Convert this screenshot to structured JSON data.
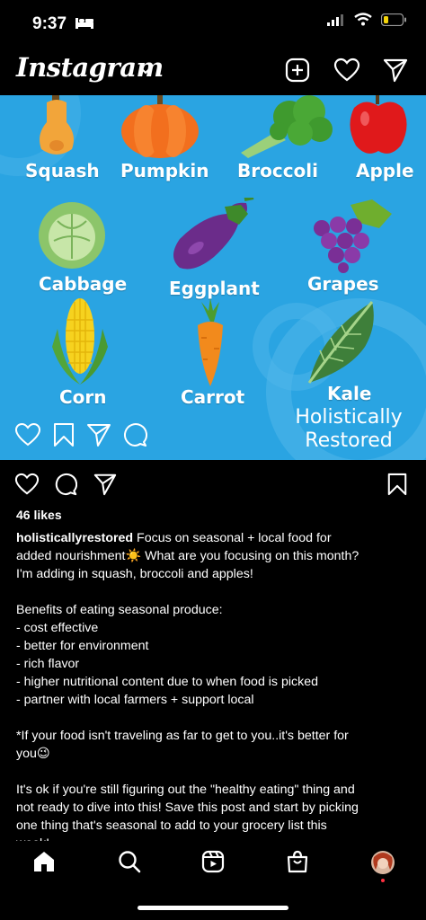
{
  "status_bar": {
    "time": "9:37",
    "icons": [
      "bed-icon",
      "signal-icon",
      "wifi-icon",
      "battery-low-icon"
    ]
  },
  "header": {
    "logo": "Instagram",
    "icons": [
      "chevron-down-icon",
      "new-post-icon",
      "heart-icon",
      "send-icon"
    ]
  },
  "post_image": {
    "produce": [
      {
        "label": "Squash"
      },
      {
        "label": "Pumpkin"
      },
      {
        "label": "Broccoli"
      },
      {
        "label": "Apple"
      },
      {
        "label": "Cabbage"
      },
      {
        "label": "Eggplant"
      },
      {
        "label": "Grapes"
      },
      {
        "label": "Corn"
      },
      {
        "label": "Carrot"
      },
      {
        "label": "Kale"
      }
    ],
    "brand_line1": "Holistically",
    "brand_line2": "Restored",
    "overlay_icons": [
      "heart-outline-icon",
      "bookmark-outline-icon",
      "send-outline-icon",
      "comment-outline-icon"
    ],
    "colors": {
      "background": "#2aa4e2"
    }
  },
  "actions": {
    "icons": [
      "like-icon",
      "comment-icon",
      "share-icon",
      "save-icon"
    ]
  },
  "likes": "46 likes",
  "caption": {
    "username": "holisticallyrestored",
    "line1_text": " Focus on seasonal + local food for",
    "line2": "added nourishment☀️ What are you focusing on this month?",
    "line3": "I'm adding in squash, broccoli and apples!",
    "benefits_title": "Benefits of eating seasonal produce:",
    "benefits": [
      "- cost effective",
      "- better for environment",
      "- rich flavor",
      "- higher nutritional content due to when food is picked",
      "- partner with local farmers + support local"
    ],
    "note_line1": "*If your food isn't traveling as far to get to you..it's better for",
    "note_line2": "you😉",
    "closing": [
      "It's ok if you're still figuring out the \"healthy eating\" thing and",
      "not ready to dive into this! Save this post and start by picking",
      "one thing that's seasonal to add to your grocery list this",
      "week!"
    ]
  },
  "bottom_nav": {
    "items": [
      "home-icon",
      "search-icon",
      "reels-icon",
      "shop-icon",
      "profile-avatar"
    ]
  }
}
